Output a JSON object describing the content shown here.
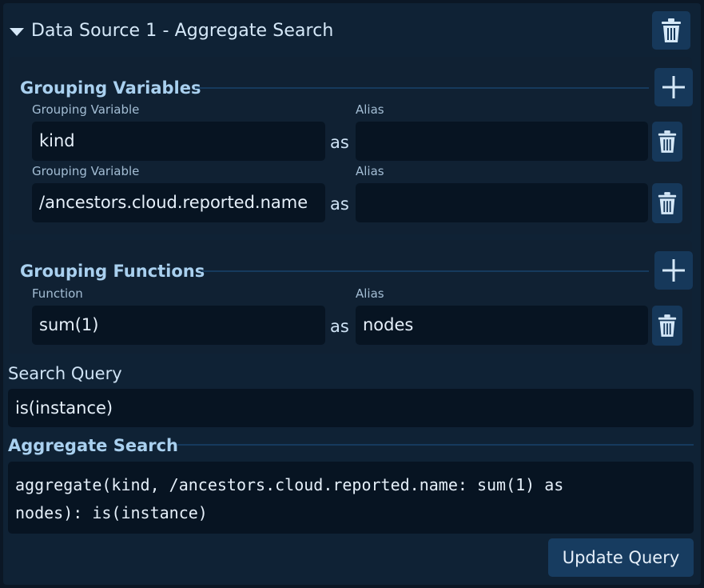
{
  "header": {
    "title": "Data Source 1 - Aggregate Search"
  },
  "grouping_variables": {
    "title": "Grouping Variables",
    "rows": [
      {
        "var_label": "Grouping Variable",
        "var_value": "kind",
        "alias_label": "Alias",
        "alias_value": "",
        "as": "as"
      },
      {
        "var_label": "Grouping Variable",
        "var_value": "/ancestors.cloud.reported.name",
        "alias_label": "Alias",
        "alias_value": "",
        "as": "as"
      }
    ]
  },
  "grouping_functions": {
    "title": "Grouping Functions",
    "rows": [
      {
        "fn_label": "Function",
        "fn_value": "sum(1)",
        "alias_label": "Alias",
        "alias_value": "nodes",
        "as": "as"
      }
    ]
  },
  "search_query": {
    "label": "Search Query",
    "value": "is(instance)"
  },
  "aggregate_search": {
    "title": "Aggregate Search",
    "text": "aggregate(kind, /ancestors.cloud.reported.name: sum(1) as\nnodes): is(instance)"
  },
  "update_button": {
    "label": "Update Query"
  },
  "icons": {
    "delete": "trash-icon",
    "add": "plus-icon",
    "collapse": "caret-down-icon"
  },
  "colors": {
    "accent_button": "#16385a",
    "field_bg": "#071422",
    "panel_bg": "#0f2235",
    "section_title": "#a9d0ef"
  }
}
